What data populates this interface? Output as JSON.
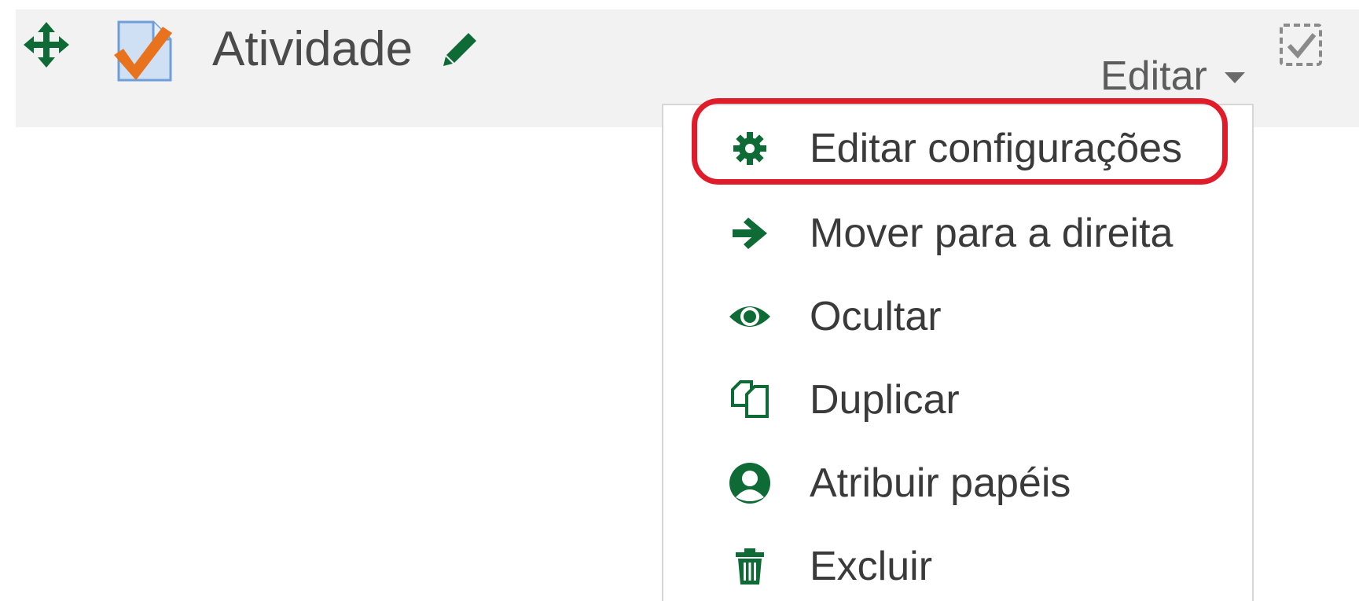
{
  "activity": {
    "name": "Atividade",
    "icon": "assignment-checkmark-icon"
  },
  "edit_menu": {
    "toggle_label": "Editar",
    "items": [
      {
        "label": "Editar configurações",
        "icon": "gear-icon"
      },
      {
        "label": "Mover para a direita",
        "icon": "arrow-right-icon"
      },
      {
        "label": "Ocultar",
        "icon": "eye-icon"
      },
      {
        "label": "Duplicar",
        "icon": "duplicate-icon"
      },
      {
        "label": "Atribuir papéis",
        "icon": "user-icon"
      },
      {
        "label": "Excluir",
        "icon": "trash-icon"
      }
    ]
  },
  "colors": {
    "icon_green": "#0f6b36",
    "highlight_red": "#e01b2a",
    "checkmark_orange": "#e8731c",
    "bar_background": "#f2f2f2"
  }
}
